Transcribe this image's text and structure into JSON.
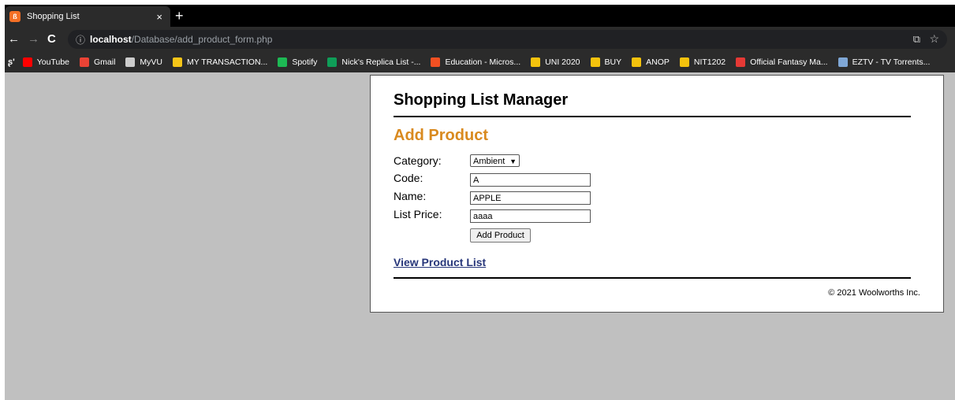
{
  "browser": {
    "tab_title": "Shopping List",
    "tab_close": "×",
    "new_tab": "+",
    "url_host": "localhost",
    "url_path": "/Database/add_product_form.php",
    "bookmarks": [
      {
        "label": "YouTube",
        "color": "#ff0000"
      },
      {
        "label": "Gmail",
        "color": "#ea4335"
      },
      {
        "label": "MyVU",
        "color": "#cccccc"
      },
      {
        "label": "MY TRANSACTION...",
        "color": "#f5c518"
      },
      {
        "label": "Spotify",
        "color": "#1db954"
      },
      {
        "label": "Nick's Replica List -...",
        "color": "#0f9d58"
      },
      {
        "label": "Education - Micros...",
        "color": "#f25022"
      },
      {
        "label": "UNI 2020",
        "color": "#f4c20d"
      },
      {
        "label": "BUY",
        "color": "#f4c20d"
      },
      {
        "label": "ANOP",
        "color": "#f4c20d"
      },
      {
        "label": "NIT1202",
        "color": "#f4c20d"
      },
      {
        "label": "Official Fantasy Ma...",
        "color": "#e53935"
      },
      {
        "label": "EZTV - TV Torrents...",
        "color": "#7fa7d6"
      }
    ]
  },
  "page": {
    "header": "Shopping List Manager",
    "section_title": "Add Product",
    "form": {
      "category_label": "Category:",
      "category_value": "Ambient",
      "code_label": "Code:",
      "code_value": "A",
      "name_label": "Name:",
      "name_value": "APPLE",
      "price_label": "List Price:",
      "price_value": "aaaa",
      "submit_label": "Add Product"
    },
    "view_link": "View Product List",
    "footer": "© 2021 Woolworths Inc."
  },
  "colors": {
    "accent": "#d98a1f",
    "link": "#27367a",
    "background": "#c0c0c0"
  }
}
